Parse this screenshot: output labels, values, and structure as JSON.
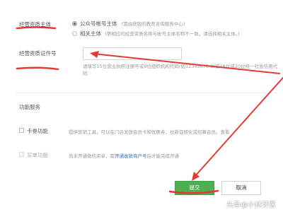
{
  "colors": {
    "accent": "#4caf50",
    "annotation": "#e53935",
    "link": "#3a6fb5"
  },
  "entity": {
    "label": "经营资质主体",
    "option1": {
      "label": "公众号帐号主体",
      "hint": "(需由获取的教育咨询服务中心)"
    },
    "option2": {
      "label": "相关主体",
      "hint": "(第相应的经营资质名称与帐号主体名称不一致，请选择相关主体。)"
    }
  },
  "license": {
    "label": "经营资质证件号",
    "hint_line1": "请填写15位营业执照注册号或9位组织机构代码(如12345678-9)或18位或20位统一社会信用代",
    "hint_line2": "码"
  },
  "services": {
    "title": "功能服务",
    "card": {
      "label": "卡券功能",
      "desc": "提供营销工具，可以在门店发放会员卡和优惠券，拉新促转化或招募会员。查看"
    },
    "buy": {
      "label": "买单功能",
      "desc": "尚未开通微信买单，需",
      "link": "开通收款商户号",
      "desc_after": "后才能完成开通"
    }
  },
  "actions": {
    "submit": "提交",
    "cancel": "取消"
  },
  "watermark": {
    "text": "头条@小林牙医"
  }
}
